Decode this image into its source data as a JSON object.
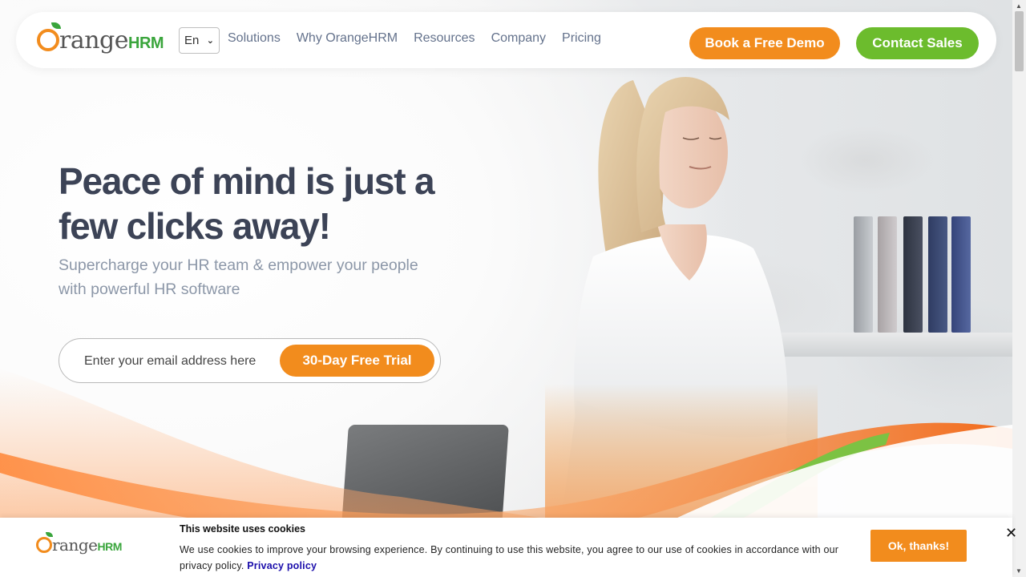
{
  "brand": {
    "logo_main": "range",
    "logo_suffix": "HRM",
    "colors": {
      "orange": "#f28c1d",
      "green": "#6cbc2d",
      "title": "#3c4356",
      "nav_text": "#64728c"
    }
  },
  "nav": {
    "language": "En",
    "links": [
      "Solutions",
      "Why OrangeHRM",
      "Resources",
      "Company",
      "Pricing"
    ],
    "demo_button": "Book a Free Demo",
    "sales_button": "Contact Sales"
  },
  "hero": {
    "title_line1": "Peace of mind is just a",
    "title_line2": "few clicks away!",
    "subtitle_line1": "Supercharge your HR team & empower your people",
    "subtitle_line2": "with powerful HR software",
    "email_placeholder": "Enter your email address here",
    "trial_button": "30-Day Free Trial"
  },
  "cookie": {
    "title": "This website uses cookies",
    "text": "We use cookies to improve your browsing experience. By continuing to use this website, you agree to our use of cookies in accordance with our privacy policy.",
    "link": "Privacy policy",
    "ok_button": "Ok, thanks!",
    "close_icon": "close-icon"
  }
}
